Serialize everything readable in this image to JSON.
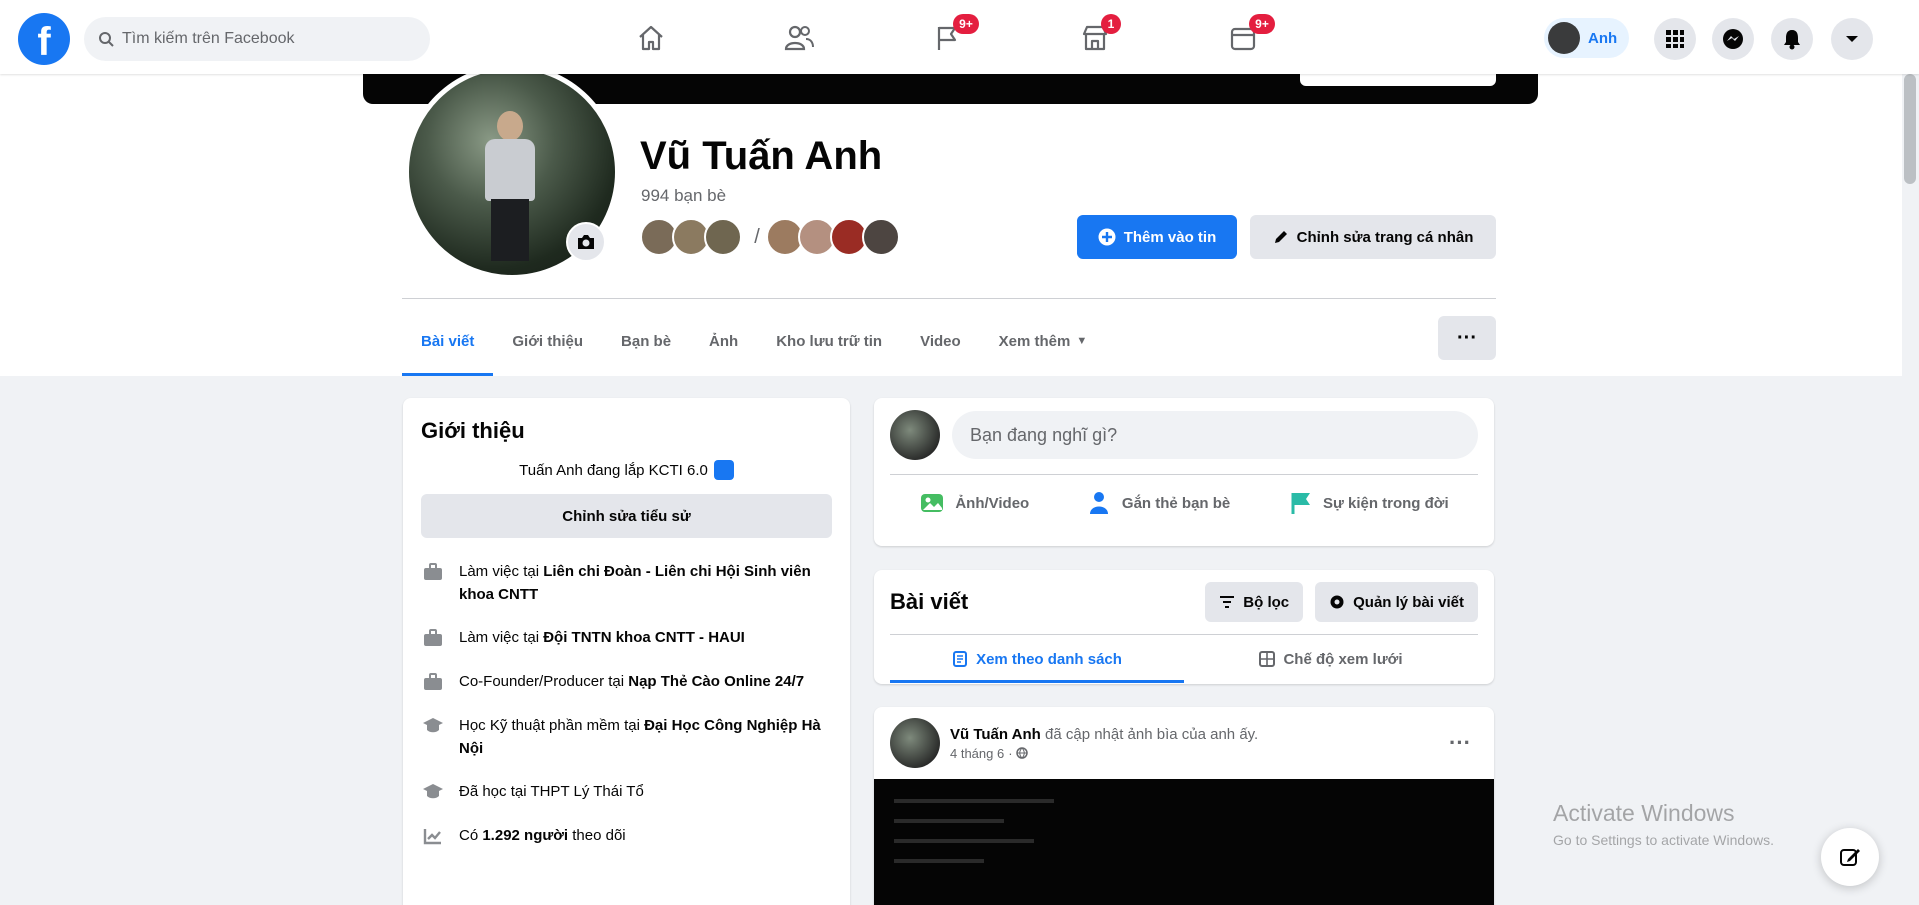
{
  "topbar": {
    "logo": "f",
    "search_placeholder": "Tìm kiếm trên Facebook",
    "nav": [
      {
        "name": "home",
        "badge": ""
      },
      {
        "name": "friends",
        "badge": ""
      },
      {
        "name": "pages",
        "badge": "9+"
      },
      {
        "name": "marketplace",
        "badge": "1"
      },
      {
        "name": "groups",
        "badge": "9+"
      }
    ],
    "profile_name": "Anh"
  },
  "profile": {
    "name": "Vũ Tuấn Anh",
    "friend_count": "994 bạn bè",
    "add_story_label": "Thêm vào tin",
    "edit_profile_label": "Chỉnh sửa trang cá nhân",
    "more_label": "···",
    "tabs": [
      "Bài viết",
      "Giới thiệu",
      "Bạn bè",
      "Ảnh",
      "Kho lưu trữ tin",
      "Video",
      "Xem thêm"
    ]
  },
  "intro": {
    "title": "Giới thiệu",
    "bio": "Tuấn Anh đang lắp KCTI 6.0",
    "edit_bio_label": "Chỉnh sửa tiểu sử",
    "items": [
      {
        "pre": "Làm việc tại ",
        "bold": "Liên chi Đoàn - Liên chi Hội Sinh viên khoa CNTT",
        "post": ""
      },
      {
        "pre": "Làm việc tại ",
        "bold": "Đội TNTN khoa CNTT - HAUI",
        "post": ""
      },
      {
        "pre": "Co-Founder/Producer tại ",
        "bold": "Nạp Thẻ Cào Online 24/7",
        "post": ""
      },
      {
        "pre": "Học Kỹ thuật phần mềm tại ",
        "bold": "Đại Học Công Nghiệp Hà Nội",
        "post": ""
      },
      {
        "pre": "Đã học tại ",
        "bold": "",
        "post": "THPT Lý Thái Tổ"
      },
      {
        "pre": "Có ",
        "bold": "1.292 người",
        "post": " theo dõi"
      }
    ]
  },
  "composer": {
    "placeholder": "Bạn đang nghĩ gì?",
    "actions": [
      "Ảnh/Video",
      "Gắn thẻ bạn bè",
      "Sự kiện trong đời"
    ]
  },
  "posts": {
    "title": "Bài viết",
    "filter_label": "Bộ lọc",
    "manage_label": "Quản lý bài viết",
    "view_tabs": [
      "Xem theo danh sách",
      "Chế độ xem lưới"
    ]
  },
  "post": {
    "author": "Vũ Tuấn Anh",
    "action": " đã cập nhật ảnh bìa của anh ấy.",
    "time": "4 tháng 6"
  },
  "watermark": {
    "line1": "Activate Windows",
    "line2": "Go to Settings to activate Windows."
  },
  "colors": {
    "accent": "#1877f2",
    "badge": "#e41e3f",
    "bg": "#f0f2f5"
  }
}
